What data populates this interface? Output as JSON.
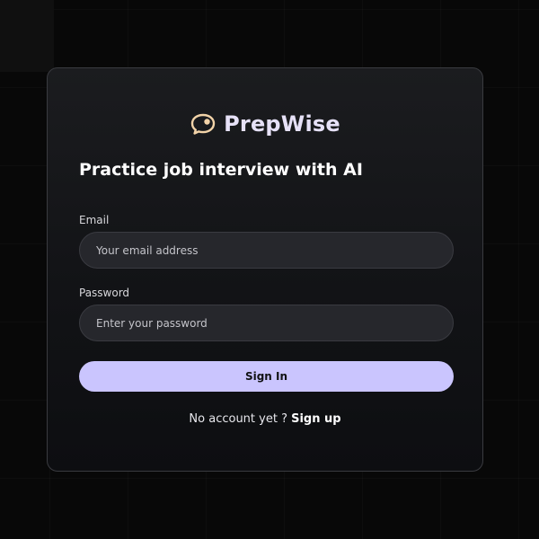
{
  "brand": {
    "name": "PrepWise",
    "icon": "chat-bubble-icon",
    "icon_color": "#f2d3a8"
  },
  "headline": "Practice job interview with AI",
  "form": {
    "email": {
      "label": "Email",
      "placeholder": "Your email address",
      "value": ""
    },
    "password": {
      "label": "Password",
      "placeholder": "Enter your password",
      "value": ""
    },
    "submit_label": "Sign In"
  },
  "footer": {
    "prompt": "No account yet ?",
    "link_label": "Sign up"
  },
  "colors": {
    "accent": "#cac5fe",
    "background": "#080808",
    "card": "#15161a"
  }
}
